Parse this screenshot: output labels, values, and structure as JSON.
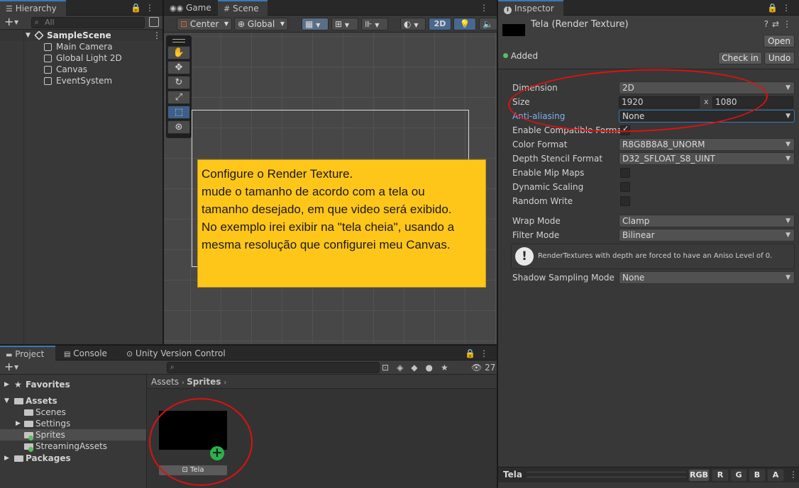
{
  "hierarchy": {
    "tab": "Hierarchy",
    "search_placeholder": "All",
    "scene": "SampleScene",
    "items": [
      "Main Camera",
      "Global Light 2D",
      "Canvas",
      "EventSystem"
    ]
  },
  "scene_view": {
    "tabs": [
      "Game",
      "Scene"
    ],
    "pivot": "Center",
    "space": "Global",
    "mode_2d": "2D",
    "note": {
      "lines": [
        "Configure o Render Texture.",
        "mude o tamanho de acordo com a tela ou",
        "tamanho desejado, em que video será exibido.",
        "No exemplo irei exibir na \"tela cheia\", usando a",
        "mesma resolução que configurei meu Canvas."
      ],
      "bg_color": "#ffc61a"
    }
  },
  "inspector": {
    "tab": "Inspector",
    "title": "Tela (Render Texture)",
    "open_label": "Open",
    "added_label": "Added",
    "checkin_label": "Check in",
    "undo_label": "Undo",
    "props": {
      "dimension_label": "Dimension",
      "dimension_value": "2D",
      "size_label": "Size",
      "size_w": "1920",
      "size_x": "x",
      "size_h": "1080",
      "aa_label": "Anti-aliasing",
      "aa_value": "None",
      "compat_label": "Enable Compatible Format",
      "color_label": "Color Format",
      "color_value": "R8G8B8A8_UNORM",
      "depth_label": "Depth Stencil Format",
      "depth_value": "D32_SFLOAT_S8_UINT",
      "mip_label": "Enable Mip Maps",
      "dyn_label": "Dynamic Scaling",
      "rw_label": "Random Write",
      "wrap_label": "Wrap Mode",
      "wrap_value": "Clamp",
      "filter_label": "Filter Mode",
      "filter_value": "Bilinear",
      "warning": "RenderTextures with depth are forced to have an Aniso Level of 0.",
      "shadow_label": "Shadow Sampling Mode",
      "shadow_value": "None"
    },
    "preview": {
      "name": "Tela",
      "channels": [
        "RGB",
        "R",
        "G",
        "B",
        "A"
      ]
    }
  },
  "project": {
    "tabs": [
      "Project",
      "Console",
      "Unity Version Control"
    ],
    "favorites": "Favorites",
    "assets": "Assets",
    "folders": [
      "Scenes",
      "Settings",
      "Sprites",
      "StreamingAssets"
    ],
    "packages": "Packages",
    "breadcrumb": [
      "Assets",
      "Sprites"
    ],
    "count": "27",
    "asset_name": "Tela"
  },
  "colors": {
    "accent": "#3a79bb",
    "annotation_red": "#e01010",
    "added_green": "#56c060"
  }
}
